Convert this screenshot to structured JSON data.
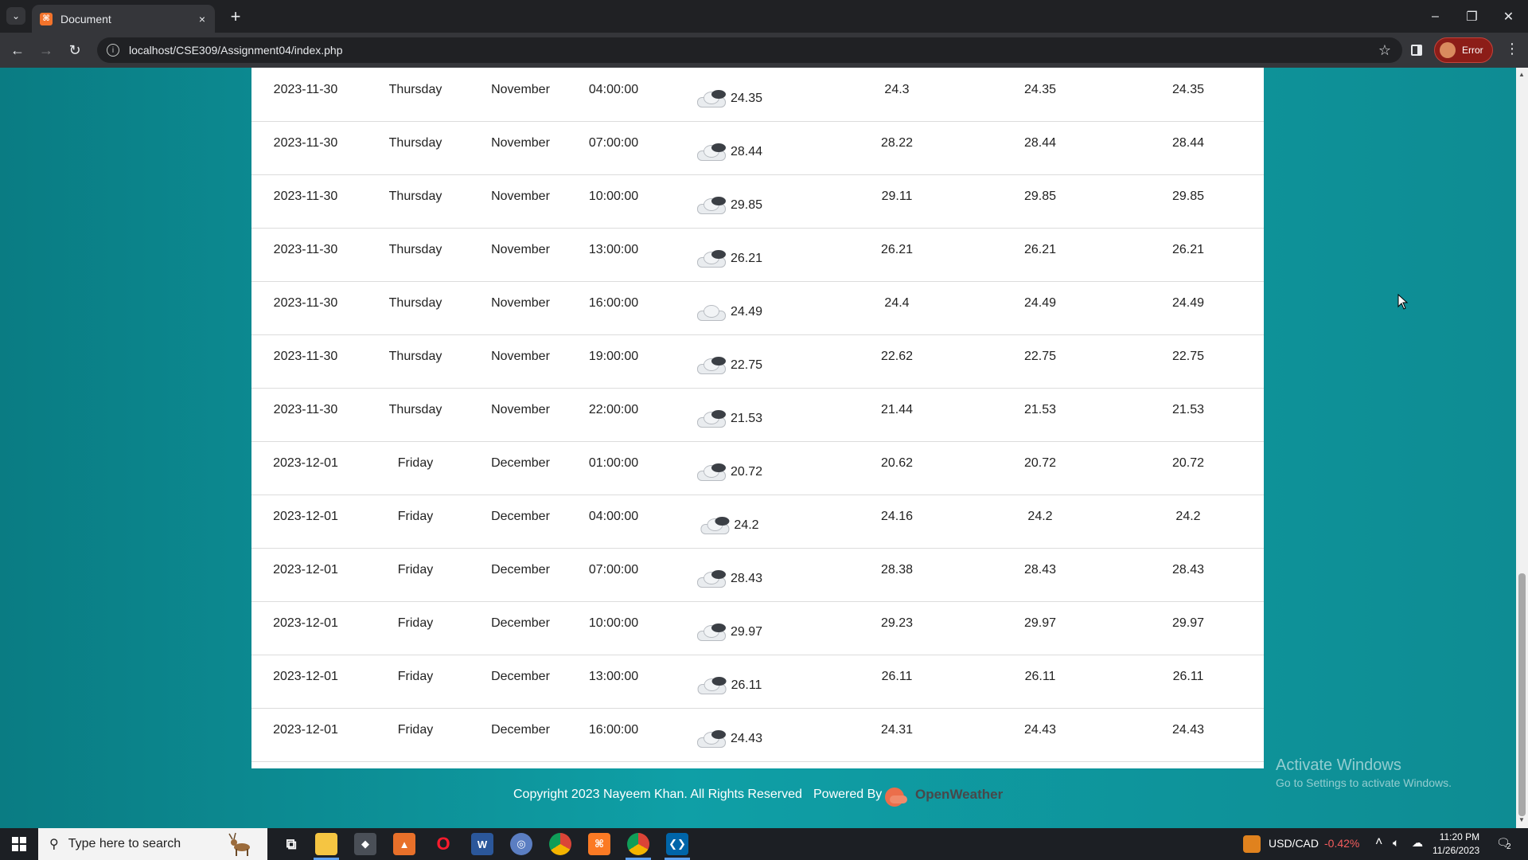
{
  "browser": {
    "tab_title": "Document",
    "url": "localhost/CSE309/Assignment04/index.php",
    "profile_status": "Error",
    "new_tab_symbol": "+",
    "close_symbol": "×"
  },
  "table": {
    "rows": [
      {
        "date": "2023-11-30",
        "day": "Thursday",
        "month": "November",
        "time": "04:00:00",
        "icon": "cloud-icon",
        "temp": "24.35",
        "c1": "24.3",
        "c2": "24.35",
        "c3": "24.35"
      },
      {
        "date": "2023-11-30",
        "day": "Thursday",
        "month": "November",
        "time": "07:00:00",
        "icon": "cloud-icon",
        "temp": "28.44",
        "c1": "28.22",
        "c2": "28.44",
        "c3": "28.44"
      },
      {
        "date": "2023-11-30",
        "day": "Thursday",
        "month": "November",
        "time": "10:00:00",
        "icon": "cloud-icon",
        "temp": "29.85",
        "c1": "29.11",
        "c2": "29.85",
        "c3": "29.85"
      },
      {
        "date": "2023-11-30",
        "day": "Thursday",
        "month": "November",
        "time": "13:00:00",
        "icon": "cloud-icon",
        "temp": "26.21",
        "c1": "26.21",
        "c2": "26.21",
        "c3": "26.21"
      },
      {
        "date": "2023-11-30",
        "day": "Thursday",
        "month": "November",
        "time": "16:00:00",
        "icon": "light-cloud-icon",
        "temp": "24.49",
        "c1": "24.4",
        "c2": "24.49",
        "c3": "24.49"
      },
      {
        "date": "2023-11-30",
        "day": "Thursday",
        "month": "November",
        "time": "19:00:00",
        "icon": "cloud-icon",
        "temp": "22.75",
        "c1": "22.62",
        "c2": "22.75",
        "c3": "22.75"
      },
      {
        "date": "2023-11-30",
        "day": "Thursday",
        "month": "November",
        "time": "22:00:00",
        "icon": "cloud-icon",
        "temp": "21.53",
        "c1": "21.44",
        "c2": "21.53",
        "c3": "21.53"
      },
      {
        "date": "2023-12-01",
        "day": "Friday",
        "month": "December",
        "time": "01:00:00",
        "icon": "cloud-icon",
        "temp": "20.72",
        "c1": "20.62",
        "c2": "20.72",
        "c3": "20.72"
      },
      {
        "date": "2023-12-01",
        "day": "Friday",
        "month": "December",
        "time": "04:00:00",
        "icon": "cloud-icon",
        "temp": "24.2",
        "c1": "24.16",
        "c2": "24.2",
        "c3": "24.2"
      },
      {
        "date": "2023-12-01",
        "day": "Friday",
        "month": "December",
        "time": "07:00:00",
        "icon": "cloud-icon",
        "temp": "28.43",
        "c1": "28.38",
        "c2": "28.43",
        "c3": "28.43"
      },
      {
        "date": "2023-12-01",
        "day": "Friday",
        "month": "December",
        "time": "10:00:00",
        "icon": "cloud-icon",
        "temp": "29.97",
        "c1": "29.23",
        "c2": "29.97",
        "c3": "29.97"
      },
      {
        "date": "2023-12-01",
        "day": "Friday",
        "month": "December",
        "time": "13:00:00",
        "icon": "cloud-icon",
        "temp": "26.11",
        "c1": "26.11",
        "c2": "26.11",
        "c3": "26.11"
      },
      {
        "date": "2023-12-01",
        "day": "Friday",
        "month": "December",
        "time": "16:00:00",
        "icon": "cloud-icon",
        "temp": "24.43",
        "c1": "24.31",
        "c2": "24.43",
        "c3": "24.43"
      }
    ]
  },
  "footer": {
    "copyright": "Copyright 2023 Nayeem Khan. All Rights Reserved",
    "powered_by": "Powered By",
    "brand": "OpenWeather"
  },
  "watermark": {
    "line1": "Activate Windows",
    "line2": "Go to Settings to activate Windows."
  },
  "taskbar": {
    "search_placeholder": "Type here to search",
    "currency_pair": "USD/CAD",
    "currency_change": "-0.42%",
    "time": "11:20 PM",
    "date": "11/26/2023",
    "notification_count": "2"
  },
  "colors": {
    "page_bg": "#0b7f86",
    "accent_blue": "#5ea0ef",
    "error_red": "#8c1d18",
    "openweather_orange": "#eb6e4b"
  }
}
